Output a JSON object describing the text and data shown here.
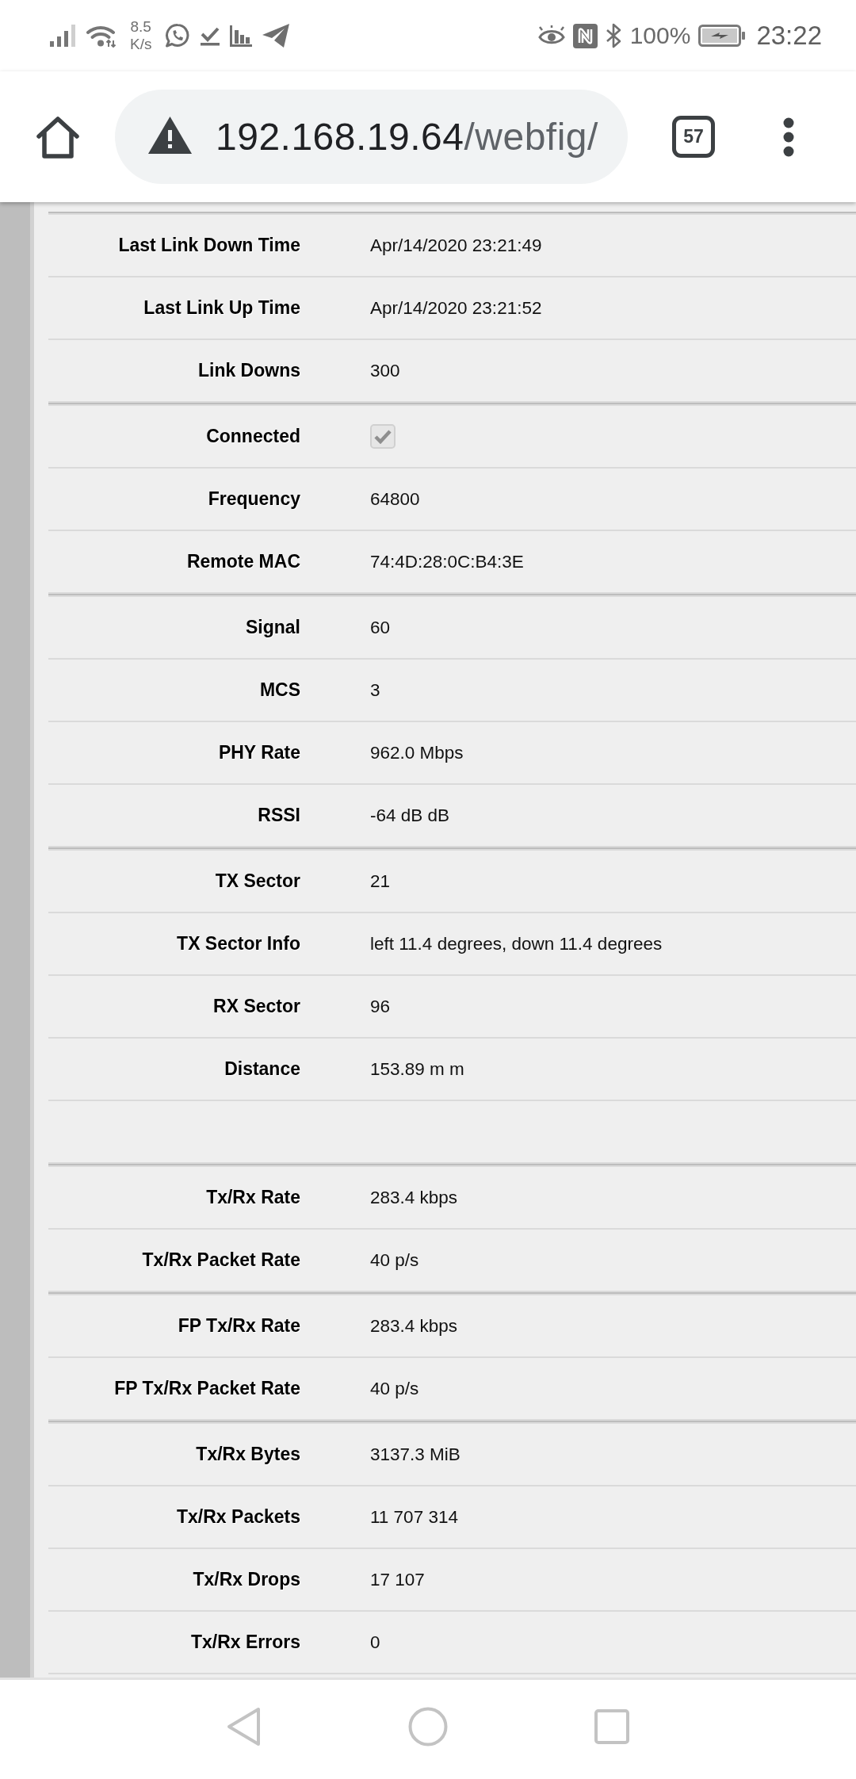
{
  "status_bar": {
    "net_speed": {
      "value": "8.5",
      "unit": "K/s"
    },
    "battery_level": "100%",
    "time": "23:22"
  },
  "browser": {
    "url": {
      "host": "192.168.19.64",
      "path": "/webfig/"
    },
    "tab_count": "57"
  },
  "groups": [
    {
      "rows": [
        {
          "kind": "text",
          "label": "Last Link Down Time",
          "value": "Apr/14/2020 23:21:49"
        },
        {
          "kind": "text",
          "label": "Last Link Up Time",
          "value": "Apr/14/2020 23:21:52"
        },
        {
          "kind": "text",
          "label": "Link Downs",
          "value": "300"
        }
      ]
    },
    {
      "rows": [
        {
          "kind": "checkbox",
          "label": "Connected",
          "checked": true,
          "disabled": true
        },
        {
          "kind": "text",
          "label": "Frequency",
          "value": "64800"
        },
        {
          "kind": "text",
          "label": "Remote MAC",
          "value": "74:4D:28:0C:B4:3E"
        }
      ]
    },
    {
      "rows": [
        {
          "kind": "text",
          "label": "Signal",
          "value": "60"
        },
        {
          "kind": "text",
          "label": "MCS",
          "value": "3"
        },
        {
          "kind": "text",
          "label": "PHY Rate",
          "value": "962.0 Mbps"
        },
        {
          "kind": "text",
          "label": "RSSI",
          "value": "-64 dB dB"
        }
      ]
    },
    {
      "rows": [
        {
          "kind": "text",
          "label": "TX Sector",
          "value": "21"
        },
        {
          "kind": "text",
          "label": "TX Sector Info",
          "value": "left 11.4 degrees, down 11.4 degrees"
        },
        {
          "kind": "text",
          "label": "RX Sector",
          "value": "96"
        },
        {
          "kind": "text",
          "label": "Distance",
          "value": "153.89 m m"
        },
        {
          "kind": "blank"
        }
      ]
    },
    {
      "rows": [
        {
          "kind": "text",
          "label": "Tx/Rx Rate",
          "value": "283.4 kbps"
        },
        {
          "kind": "text",
          "label": "Tx/Rx Packet Rate",
          "value": "40 p/s"
        }
      ]
    },
    {
      "rows": [
        {
          "kind": "text",
          "label": "FP Tx/Rx Rate",
          "value": "283.4 kbps"
        },
        {
          "kind": "text",
          "label": "FP Tx/Rx Packet Rate",
          "value": "40 p/s"
        }
      ]
    },
    {
      "rows": [
        {
          "kind": "text",
          "label": "Tx/Rx Bytes",
          "value": "3137.3 MiB"
        },
        {
          "kind": "text",
          "label": "Tx/Rx Packets",
          "value": "11 707 314"
        },
        {
          "kind": "text",
          "label": "Tx/Rx Drops",
          "value": "17 107"
        },
        {
          "kind": "text",
          "label": "Tx/Rx Errors",
          "value": "0"
        }
      ]
    }
  ]
}
